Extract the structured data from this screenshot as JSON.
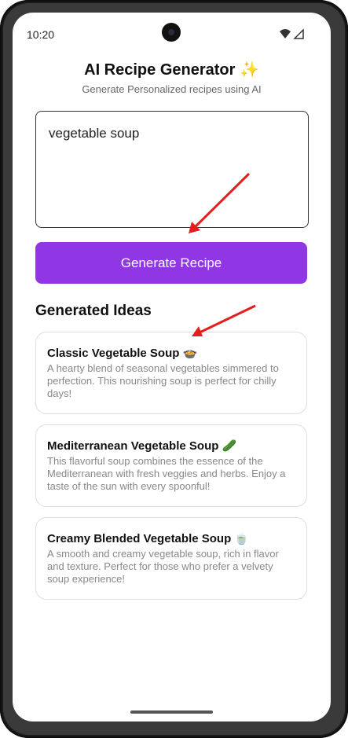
{
  "status_bar": {
    "time": "10:20"
  },
  "header": {
    "title": "AI Recipe Generator ✨",
    "subtitle": "Generate Personalized recipes using AI"
  },
  "prompt": {
    "value": "vegetable soup"
  },
  "generate_button": {
    "label": "Generate Recipe"
  },
  "ideas_section": {
    "title": "Generated Ideas",
    "items": [
      {
        "title": "Classic Vegetable Soup 🍲",
        "description": "A hearty blend of seasonal vegetables simmered to perfection. This nourishing soup is perfect for chilly days!"
      },
      {
        "title": "Mediterranean Vegetable Soup 🥒",
        "description": "This flavorful soup combines the essence of the Mediterranean with fresh veggies and herbs. Enjoy a taste of the sun with every spoonful!"
      },
      {
        "title": "Creamy Blended Vegetable Soup 🍵",
        "description": "A smooth and creamy vegetable soup, rich in flavor and texture. Perfect for those who prefer a velvety soup experience!"
      }
    ]
  },
  "colors": {
    "accent": "#9136e4",
    "annotation_arrow": "#e51d1d"
  },
  "icons": [
    "camera-icon",
    "wifi-icon",
    "signal-icon",
    "annotation-arrow"
  ]
}
